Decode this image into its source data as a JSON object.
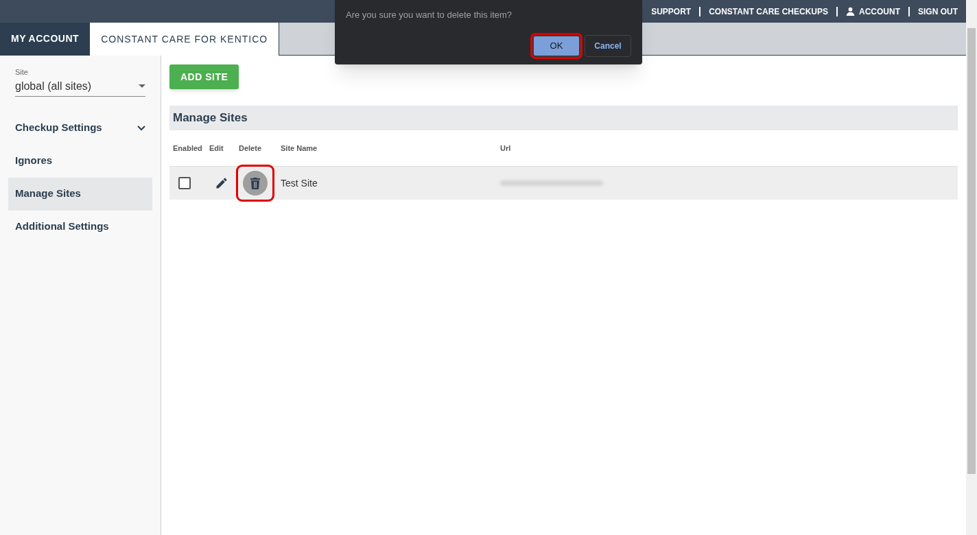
{
  "top_nav": [
    {
      "label": "SUPPORT",
      "kind": "link"
    },
    {
      "label": "CONSTANT CARE CHECKUPS",
      "kind": "link"
    },
    {
      "label": "ACCOUNT",
      "kind": "account"
    },
    {
      "label": "SIGN OUT",
      "kind": "link"
    }
  ],
  "tabs": [
    {
      "label": "MY ACCOUNT",
      "selected": false
    },
    {
      "label": "CONSTANT CARE FOR KENTICO",
      "selected": true
    }
  ],
  "sidebar": {
    "site_select": {
      "label": "Site",
      "value": "global (all sites)"
    },
    "items": [
      {
        "label": "Checkup Settings",
        "selected": false,
        "expandable": true
      },
      {
        "label": "Ignores",
        "selected": false,
        "expandable": false
      },
      {
        "label": "Manage Sites",
        "selected": true,
        "expandable": false
      },
      {
        "label": "Additional Settings",
        "selected": false,
        "expandable": false
      }
    ]
  },
  "add_button": "ADD SITE",
  "section_title": "Manage Sites",
  "table": {
    "columns": [
      "Enabled",
      "Edit",
      "Delete",
      "Site Name",
      "Url"
    ],
    "rows": [
      {
        "enabled": false,
        "delete_highlighted": true,
        "site_name": "Test Site"
      }
    ]
  },
  "dialog": {
    "message": "Are you sure you want to delete this item?",
    "ok": {
      "label": "OK",
      "highlighted": true
    },
    "cancel": {
      "label": "Cancel"
    }
  }
}
